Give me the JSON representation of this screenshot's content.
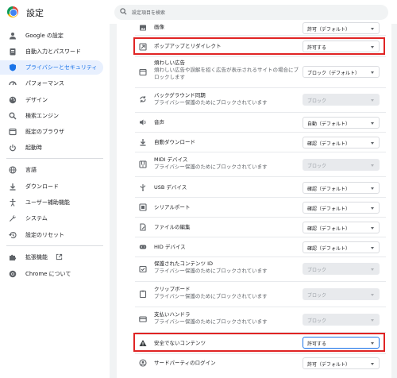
{
  "header": {
    "app_title": "設定",
    "search_placeholder": "設定項目を検索"
  },
  "sidebar": {
    "items": [
      {
        "label": "Google の設定",
        "icon": "person-icon"
      },
      {
        "label": "自動入力とパスワード",
        "icon": "clipboard-icon"
      },
      {
        "label": "プライバシーとセキュリティ",
        "icon": "shield-icon",
        "active": true
      },
      {
        "label": "パフォーマンス",
        "icon": "speedometer-icon"
      },
      {
        "label": "デザイン",
        "icon": "palette-icon"
      },
      {
        "label": "検索エンジン",
        "icon": "search-icon"
      },
      {
        "label": "既定のブラウザ",
        "icon": "browser-icon"
      },
      {
        "label": "起動時",
        "icon": "power-icon"
      },
      {
        "label": "言語",
        "icon": "globe-icon"
      },
      {
        "label": "ダウンロード",
        "icon": "download-icon"
      },
      {
        "label": "ユーザー補助機能",
        "icon": "accessibility-icon"
      },
      {
        "label": "システム",
        "icon": "wrench-icon"
      },
      {
        "label": "設定のリセット",
        "icon": "history-icon"
      },
      {
        "label": "拡張機能",
        "icon": "puzzle-icon",
        "extra_icon": "external-link-icon"
      },
      {
        "label": "Chrome について",
        "icon": "chrome-icon"
      }
    ]
  },
  "settings": {
    "rows": [
      {
        "title": "画像",
        "subtitle": "",
        "icon": "image-icon",
        "value": "許可（デフォルト）",
        "disabled": false
      },
      {
        "title": "ポップアップとリダイレクト",
        "subtitle": "",
        "icon": "popup-icon",
        "value": "許可する",
        "disabled": false,
        "highlighted": true
      },
      {
        "title": "煩わしい広告",
        "subtitle": "煩わしい広告や誤解を招く広告が表示されるサイトの場合にブロックします",
        "icon": "ad-icon",
        "value": "ブロック（デフォルト）",
        "disabled": false
      },
      {
        "title": "バックグラウンド同期",
        "subtitle": "プライバシー保護のためにブロックされています",
        "icon": "sync-icon",
        "value": "ブロック",
        "disabled": true
      },
      {
        "title": "音声",
        "subtitle": "",
        "icon": "volume-icon",
        "value": "自動（デフォルト）",
        "disabled": false
      },
      {
        "title": "自動ダウンロード",
        "subtitle": "",
        "icon": "download-icon",
        "value": "確認（デフォルト）",
        "disabled": false
      },
      {
        "title": "MIDI デバイス",
        "subtitle": "プライバシー保護のためにブロックされています",
        "icon": "piano-icon",
        "value": "ブロック",
        "disabled": true
      },
      {
        "title": "USB デバイス",
        "subtitle": "",
        "icon": "usb-icon",
        "value": "確認（デフォルト）",
        "disabled": false
      },
      {
        "title": "シリアルポート",
        "subtitle": "",
        "icon": "serial-port-icon",
        "value": "確認（デフォルト）",
        "disabled": false
      },
      {
        "title": "ファイルの編集",
        "subtitle": "",
        "icon": "file-edit-icon",
        "value": "確認（デフォルト）",
        "disabled": false
      },
      {
        "title": "HID デバイス",
        "subtitle": "",
        "icon": "gamepad-icon",
        "value": "確認（デフォルト）",
        "disabled": false
      },
      {
        "title": "保護されたコンテンツ ID",
        "subtitle": "プライバシー保護のためにブロックされています",
        "icon": "protected-content-icon",
        "value": "ブロック",
        "disabled": true
      },
      {
        "title": "クリップボード",
        "subtitle": "プライバシー保護のためにブロックされています",
        "icon": "clipboard-icon",
        "value": "ブロック",
        "disabled": true
      },
      {
        "title": "支払いハンドラ",
        "subtitle": "プライバシー保護のためにブロックされています",
        "icon": "credit-card-icon",
        "value": "ブロック",
        "disabled": true
      },
      {
        "title": "安全でないコンテンツ",
        "subtitle": "",
        "icon": "warning-icon",
        "value": "許可する",
        "disabled": false,
        "highlighted": true,
        "focused": true
      },
      {
        "title": "サードパーティのログイン",
        "subtitle": "",
        "icon": "account-circle-icon",
        "value": "許可（デフォルト）",
        "disabled": false
      }
    ]
  },
  "colors": {
    "accent": "#1a73e8",
    "highlight": "#e02424",
    "active_bg": "#e8f0fe"
  }
}
